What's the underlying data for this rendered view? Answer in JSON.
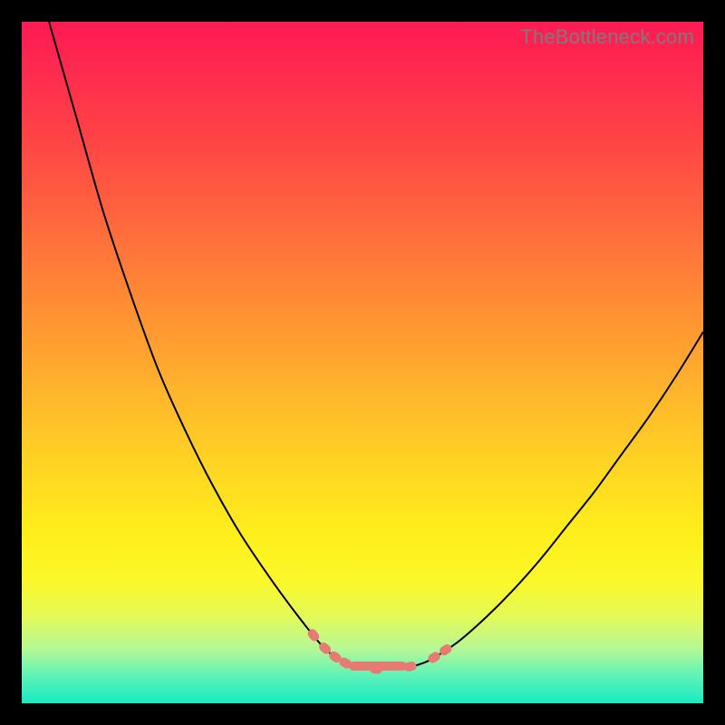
{
  "watermark": "TheBottleneck.com",
  "colors": {
    "frame": "#000000",
    "curve": "#000000",
    "blob": "#e87a74",
    "gradient_top": "#ff1a53",
    "gradient_bottom": "#18e9c0"
  },
  "chart_data": {
    "type": "line",
    "title": "",
    "xlabel": "",
    "ylabel": "",
    "xlim": [
      0,
      100
    ],
    "ylim": [
      0,
      100
    ],
    "series": [
      {
        "name": "left-curve",
        "x": [
          4,
          8,
          12,
          16,
          20,
          24,
          28,
          32,
          36,
          40,
          44,
          46,
          48
        ],
        "y": [
          100,
          86,
          72,
          60,
          49,
          40,
          32,
          25,
          19,
          13.5,
          8.5,
          6.8,
          5.6
        ]
      },
      {
        "name": "right-curve",
        "x": [
          58,
          60,
          64,
          68,
          72,
          76,
          80,
          84,
          88,
          92,
          96,
          100
        ],
        "y": [
          5.6,
          6.4,
          9,
          12.5,
          16.5,
          21,
          26,
          31,
          36.5,
          42,
          48,
          54.5
        ]
      },
      {
        "name": "flat-bottom",
        "x": [
          48,
          50,
          52,
          54,
          56,
          58
        ],
        "y": [
          5.6,
          5.2,
          5.0,
          5.0,
          5.2,
          5.6
        ]
      }
    ],
    "annotations": {
      "salmon_dashes_x": [
        42.8,
        44.5,
        46.0,
        47.5,
        52.0,
        57.0,
        60.5,
        62.2
      ],
      "salmon_bar_x_range": [
        48.0,
        56.5
      ]
    }
  }
}
